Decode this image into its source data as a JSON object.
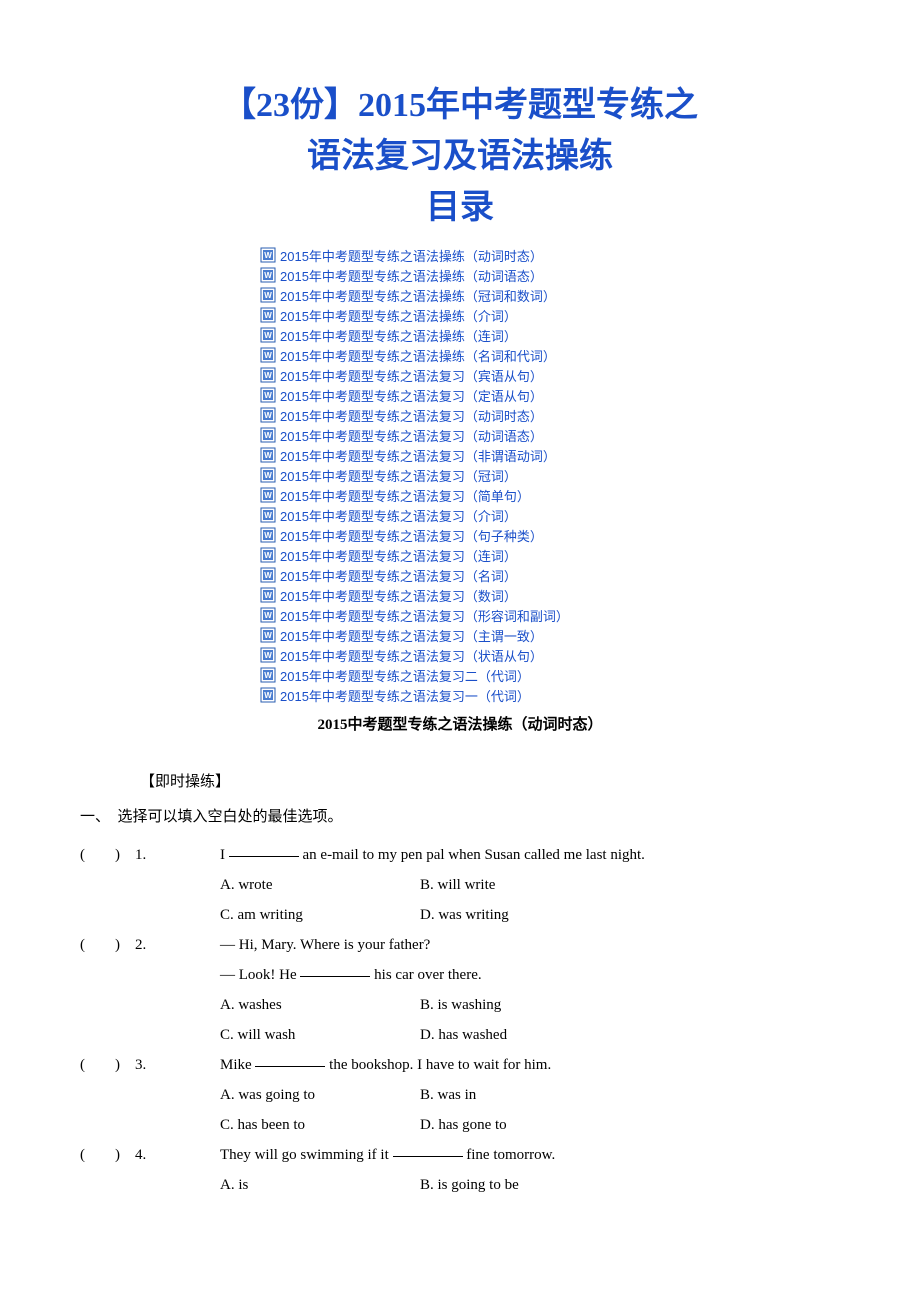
{
  "title_line1": "【23份】2015年中考题型专练之",
  "title_line2": "语法复习及语法操练",
  "title_line3": "目录",
  "toc_items": [
    "2015年中考题型专练之语法操练（动词时态）",
    "2015年中考题型专练之语法操练（动词语态）",
    "2015年中考题型专练之语法操练（冠词和数词）",
    "2015年中考题型专练之语法操练（介词）",
    "2015年中考题型专练之语法操练（连词）",
    "2015年中考题型专练之语法操练（名词和代词）",
    "2015年中考题型专练之语法复习（宾语从句）",
    "2015年中考题型专练之语法复习（定语从句）",
    "2015年中考题型专练之语法复习（动词时态）",
    "2015年中考题型专练之语法复习（动词语态）",
    "2015年中考题型专练之语法复习（非谓语动词）",
    "2015年中考题型专练之语法复习（冠词）",
    "2015年中考题型专练之语法复习（简单句）",
    "2015年中考题型专练之语法复习（介词）",
    "2015年中考题型专练之语法复习（句子种类）",
    "2015年中考题型专练之语法复习（连词）",
    "2015年中考题型专练之语法复习（名词）",
    "2015年中考题型专练之语法复习（数词）",
    "2015年中考题型专练之语法复习（形容词和副词）",
    "2015年中考题型专练之语法复习（主谓一致）",
    "2015年中考题型专练之语法复习（状语从句）",
    "2015年中考题型专练之语法复习二（代词）",
    "2015年中考题型专练之语法复习一（代词）"
  ],
  "section_title": "2015中考题型专练之语法操练（动词时态）",
  "practice_heading": "【即时操练】",
  "instruction": "一、　选择可以填入空白处的最佳选项。",
  "questions": [
    {
      "num": "(　　)　1. ",
      "stem_before": "I ",
      "stem_after": " an e-mail to my pen pal when Susan called me last night.",
      "opts": [
        {
          "a": "A. wrote",
          "b": "B. will write"
        },
        {
          "a": "C. am writing",
          "b": "D. was writing"
        }
      ]
    },
    {
      "num": "(　　)　2. ",
      "stem_before": "— Hi, Mary. Where is your father?",
      "stem_after": "",
      "line2_before": "— Look! He ",
      "line2_after": " his car over there.",
      "opts": [
        {
          "a": "A. washes",
          "b": "B. is washing"
        },
        {
          "a": "C. will wash",
          "b": "D. has washed"
        }
      ]
    },
    {
      "num": "(　　)　3. ",
      "stem_before": "Mike ",
      "stem_after": " the bookshop. I have to wait for him.",
      "opts": [
        {
          "a": "A. was going to",
          "b": "B. was in"
        },
        {
          "a": "C. has been to",
          "b": "D. has gone to"
        }
      ]
    },
    {
      "num": "(　　)　4. ",
      "stem_before": "They will go swimming if it ",
      "stem_after": " fine tomorrow.",
      "opts": [
        {
          "a": "A. is",
          "b": "B. is going to be"
        }
      ]
    }
  ]
}
